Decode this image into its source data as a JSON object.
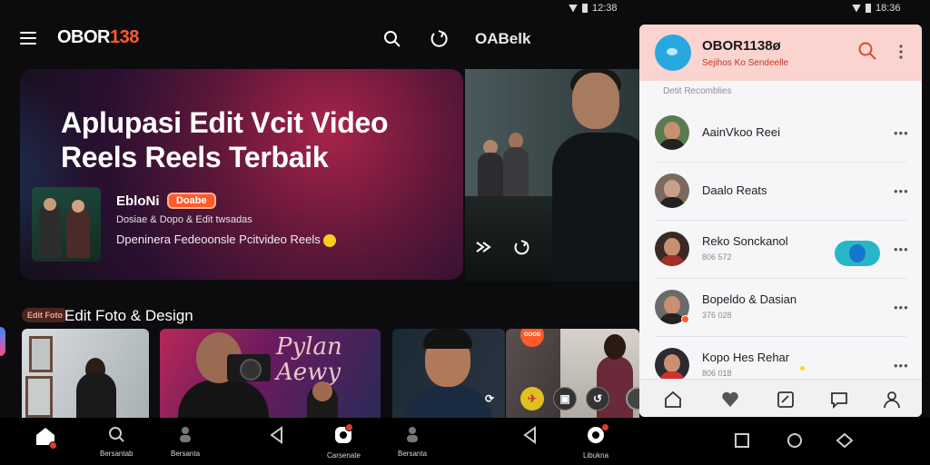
{
  "status_left": {
    "time": "12:38"
  },
  "status_right": {
    "time": "18:36"
  },
  "topbar": {
    "logo_main": "OBOR",
    "logo_accent": "138",
    "title": "OABelk"
  },
  "hero": {
    "title": "Aplupasi Edit Vcit Video Reels Reels Terbaik",
    "name": "EbloNi",
    "badge": "Doabe",
    "sub1": "Dosiae & Dopo & Edit twsadas",
    "sub2": "Dpeninera Fedeoonsle Pcitvideo Reels"
  },
  "section": {
    "tag": "Edit Foto",
    "title": "Edit Foto & Design"
  },
  "cards": {
    "c2_sign": "Pylan Aewy",
    "c4_badge": "GOOB"
  },
  "bottom_nav": {
    "item2": "Bersantab",
    "item3": "Bersanta",
    "item5": "Carsenate",
    "item6": "Bersanta",
    "item8": "Libukna"
  },
  "panel": {
    "title": "OBOR1138ø",
    "subtitle": "Sejihos Ko Sendeelle",
    "section": "Detit Recomblies",
    "rows": [
      {
        "name": "AainVkoo Reei",
        "meta": ""
      },
      {
        "name": "Daalo Reats",
        "meta": ""
      },
      {
        "name": "Reko Sonckanol",
        "meta": "806 572"
      },
      {
        "name": "Bopeldo & Dasian",
        "meta": "376 028"
      },
      {
        "name": "Kopo Hes Rehar",
        "meta": "806 018"
      }
    ]
  },
  "colors": {
    "accent": "#ff5a2a",
    "panel_header": "#fbd4cf",
    "toggle": "#27b6c8"
  }
}
